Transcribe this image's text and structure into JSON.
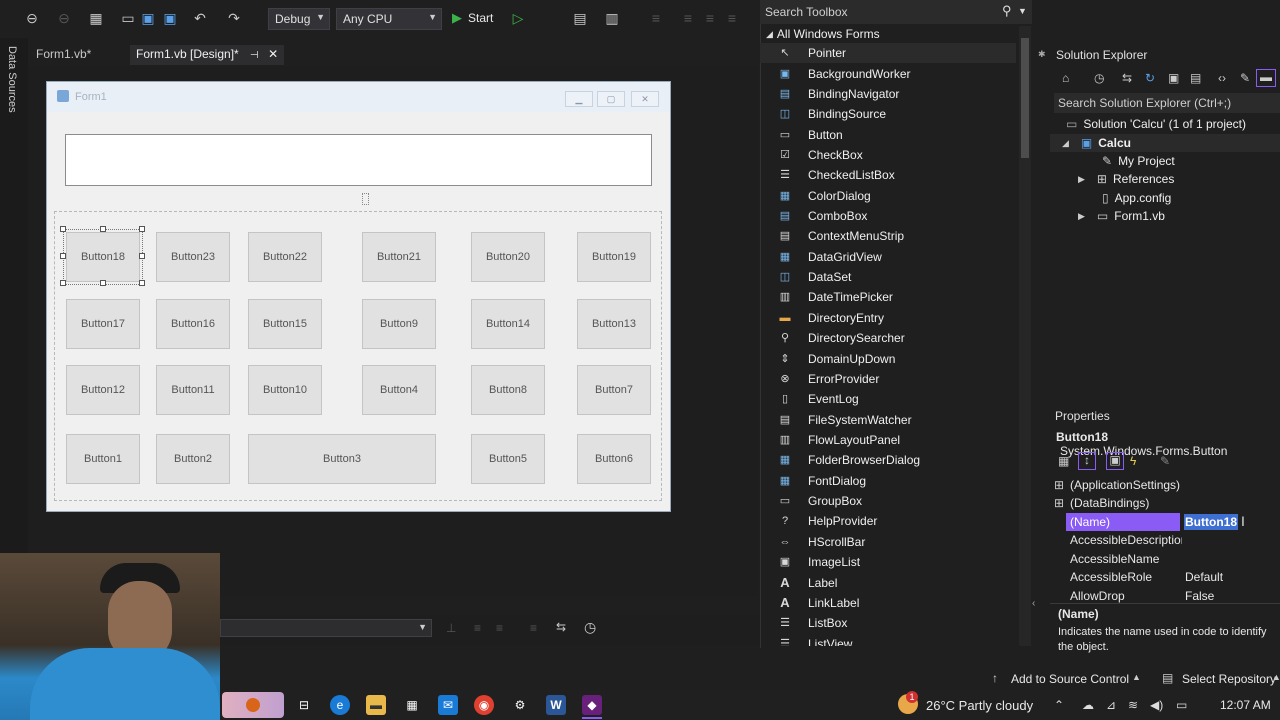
{
  "toolbar": {
    "config": "Debug",
    "platform": "Any CPU",
    "start_label": "Start"
  },
  "left_strip": {
    "data_sources": "Data Sources"
  },
  "tabs": [
    {
      "label": "Form1.vb*"
    },
    {
      "label": "Form1.vb [Design]*"
    }
  ],
  "form": {
    "title": "Form1",
    "buttons": {
      "b18": "Button18",
      "b23": "Button23",
      "b22": "Button22",
      "b21": "Button21",
      "b20": "Button20",
      "b19": "Button19",
      "b17": "Button17",
      "b16": "Button16",
      "b15": "Button15",
      "b9": "Button9",
      "b14": "Button14",
      "b13": "Button13",
      "b12": "Button12",
      "b11": "Button11",
      "b10": "Button10",
      "b4": "Button4",
      "b8": "Button8",
      "b7": "Button7",
      "b1": "Button1",
      "b2": "Button2",
      "b3": "Button3",
      "b5": "Button5",
      "b6": "Button6"
    }
  },
  "toolbox": {
    "search_placeholder": "Search Toolbox",
    "group": "All Windows Forms",
    "items": [
      "Pointer",
      "BackgroundWorker",
      "BindingNavigator",
      "BindingSource",
      "Button",
      "CheckBox",
      "CheckedListBox",
      "ColorDialog",
      "ComboBox",
      "ContextMenuStrip",
      "DataGridView",
      "DataSet",
      "DateTimePicker",
      "DirectoryEntry",
      "DirectorySearcher",
      "DomainUpDown",
      "ErrorProvider",
      "EventLog",
      "FileSystemWatcher",
      "FlowLayoutPanel",
      "FolderBrowserDialog",
      "FontDialog",
      "GroupBox",
      "HelpProvider",
      "HScrollBar",
      "ImageList",
      "Label",
      "LinkLabel",
      "ListBox",
      "ListView"
    ]
  },
  "solution_explorer": {
    "title": "Solution Explorer",
    "search_placeholder": "Search Solution Explorer (Ctrl+;)",
    "solution": "Solution 'Calcu' (1 of 1 project)",
    "project": "Calcu",
    "items": [
      "My Project",
      "References",
      "App.config",
      "Form1.vb"
    ]
  },
  "properties": {
    "title": "Properties",
    "object_name": "Button18",
    "object_type": "System.Windows.Forms.Button",
    "rows": [
      {
        "name": "(ApplicationSettings)",
        "value": ""
      },
      {
        "name": "(DataBindings)",
        "value": ""
      },
      {
        "name": "(Name)",
        "value": "Button18"
      },
      {
        "name": "AccessibleDescriptior",
        "value": ""
      },
      {
        "name": "AccessibleName",
        "value": ""
      },
      {
        "name": "AccessibleRole",
        "value": "Default"
      },
      {
        "name": "AllowDrop",
        "value": "False"
      }
    ],
    "desc_title": "(Name)",
    "desc_text": "Indicates the name used in code to identify the object."
  },
  "status": {
    "source_control": "Add to Source Control",
    "repository": "Select Repository"
  },
  "taskbar": {
    "weather": "26°C  Partly cloudy",
    "time": "12:07 AM",
    "notif_count": "1"
  },
  "colors": {
    "accent": "#8a5cf5",
    "selection": "#3f3fa0"
  }
}
